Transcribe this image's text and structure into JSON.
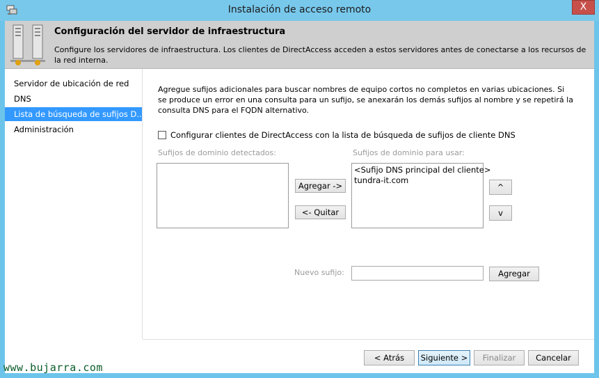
{
  "window": {
    "title": "Instalación de acceso remoto",
    "close_glyph": "X"
  },
  "header": {
    "title": "Configuración del servidor de infraestructura",
    "description": "Configure los servidores de infraestructura. Los clientes de DirectAccess acceden a estos servidores antes de conectarse a los recursos de la red interna.",
    "icon": "server-icon"
  },
  "sidebar": {
    "items": [
      {
        "label": "Servidor de ubicación de red",
        "selected": false
      },
      {
        "label": "DNS",
        "selected": false
      },
      {
        "label": "Lista de búsqueda de sufijos D...",
        "selected": true
      },
      {
        "label": "Administración",
        "selected": false
      }
    ]
  },
  "main": {
    "intro": "Agregue sufijos adicionales para buscar nombres de equipo cortos no completos en varias ubicaciones. Si se produce un error en una consulta para un sufijo, se anexarán los demás sufijos al nombre y se repetirá la consulta DNS para el FQDN alternativo.",
    "checkbox_label": "Configurar clientes de DirectAccess con la lista de búsqueda de sufijos de cliente DNS",
    "checkbox_checked": false,
    "detected_label": "Sufijos de dominio detectados:",
    "detected_items": [],
    "use_label": "Sufijos de dominio para usar:",
    "use_items": [
      "<Sufijo DNS principal del cliente>",
      "tundra-it.com"
    ],
    "add_arrow_label": "Agregar ->",
    "remove_arrow_label": "<- Quitar",
    "move_up_label": "^",
    "move_down_label": "v",
    "new_suffix_label": "Nuevo sufijo:",
    "new_suffix_value": "",
    "add_label": "Agregar"
  },
  "footer": {
    "back_label": "< Atrás",
    "next_label": "Siguiente >",
    "finish_label": "Finalizar",
    "cancel_label": "Cancelar"
  },
  "watermark": "www.bujarra.com",
  "colors": {
    "titlebar": "#78c8ec",
    "selection": "#3399ff",
    "close": "#c7504b",
    "header": "#cfcfcf"
  }
}
